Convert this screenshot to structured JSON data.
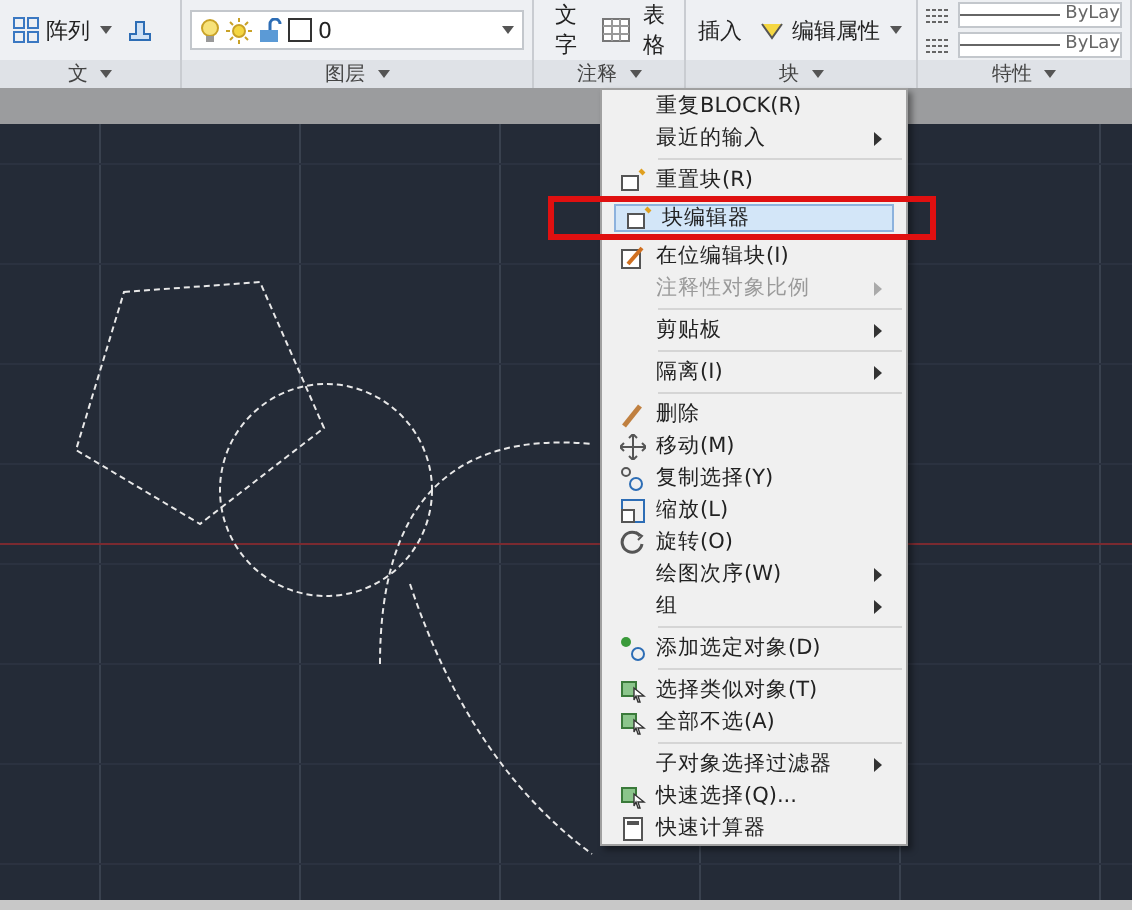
{
  "ribbon": {
    "panels": [
      {
        "kind": "modify",
        "label": "文",
        "tools": [
          {
            "label": "阵列"
          }
        ]
      },
      {
        "kind": "layers",
        "label": "图层",
        "layer": {
          "value": "0"
        }
      },
      {
        "kind": "annotation",
        "label": "注释",
        "tools": [
          {
            "label": "文字"
          },
          {
            "label": "表格"
          }
        ]
      },
      {
        "kind": "block",
        "label": "块",
        "tools": [
          {
            "label": "插入"
          },
          {
            "label": "编辑属性"
          }
        ]
      },
      {
        "kind": "properties",
        "label": "特性",
        "tools": [
          {
            "label": "ByLay"
          },
          {
            "label": "ByLay"
          }
        ]
      }
    ]
  },
  "context_menu": {
    "items": [
      {
        "kind": "item",
        "label": "重复BLOCK(R)",
        "submenu": false,
        "disabled": false,
        "selected": false
      },
      {
        "kind": "item",
        "label": "最近的输入",
        "submenu": true,
        "disabled": false,
        "selected": false
      },
      {
        "kind": "separator"
      },
      {
        "kind": "item",
        "label": "重置块(R)",
        "submenu": false,
        "disabled": false,
        "selected": false
      },
      {
        "kind": "item",
        "label": "块编辑器",
        "submenu": false,
        "disabled": false,
        "selected": true
      },
      {
        "kind": "item",
        "label": "在位编辑块(I)",
        "submenu": false,
        "disabled": false,
        "selected": false
      },
      {
        "kind": "item",
        "label": "注释性对象比例",
        "submenu": true,
        "disabled": true,
        "selected": false
      },
      {
        "kind": "separator"
      },
      {
        "kind": "item",
        "label": "剪贴板",
        "submenu": true,
        "disabled": false,
        "selected": false
      },
      {
        "kind": "separator"
      },
      {
        "kind": "item",
        "label": "隔离(I)",
        "submenu": true,
        "disabled": false,
        "selected": false
      },
      {
        "kind": "separator"
      },
      {
        "kind": "item",
        "label": "删除",
        "submenu": false,
        "disabled": false,
        "selected": false
      },
      {
        "kind": "item",
        "label": "移动(M)",
        "submenu": false,
        "disabled": false,
        "selected": false
      },
      {
        "kind": "item",
        "label": "复制选择(Y)",
        "submenu": false,
        "disabled": false,
        "selected": false
      },
      {
        "kind": "item",
        "label": "缩放(L)",
        "submenu": false,
        "disabled": false,
        "selected": false
      },
      {
        "kind": "item",
        "label": "旋转(O)",
        "submenu": false,
        "disabled": false,
        "selected": false
      },
      {
        "kind": "item",
        "label": "绘图次序(W)",
        "submenu": true,
        "disabled": false,
        "selected": false
      },
      {
        "kind": "item",
        "label": "组",
        "submenu": true,
        "disabled": false,
        "selected": false
      },
      {
        "kind": "separator"
      },
      {
        "kind": "item",
        "label": "添加选定对象(D)",
        "submenu": false,
        "disabled": false,
        "selected": false
      },
      {
        "kind": "separator"
      },
      {
        "kind": "item",
        "label": "选择类似对象(T)",
        "submenu": false,
        "disabled": false,
        "selected": false
      },
      {
        "kind": "item",
        "label": "全部不选(A)",
        "submenu": false,
        "disabled": false,
        "selected": false
      },
      {
        "kind": "separator"
      },
      {
        "kind": "item",
        "label": "子对象选择过滤器",
        "submenu": true,
        "disabled": false,
        "selected": false
      },
      {
        "kind": "item",
        "label": "快速选择(Q)...",
        "submenu": false,
        "disabled": false,
        "selected": false
      },
      {
        "kind": "item",
        "label": "快速计算器",
        "submenu": false,
        "disabled": false,
        "selected": false
      }
    ]
  },
  "highlight_box": {
    "on": true
  }
}
